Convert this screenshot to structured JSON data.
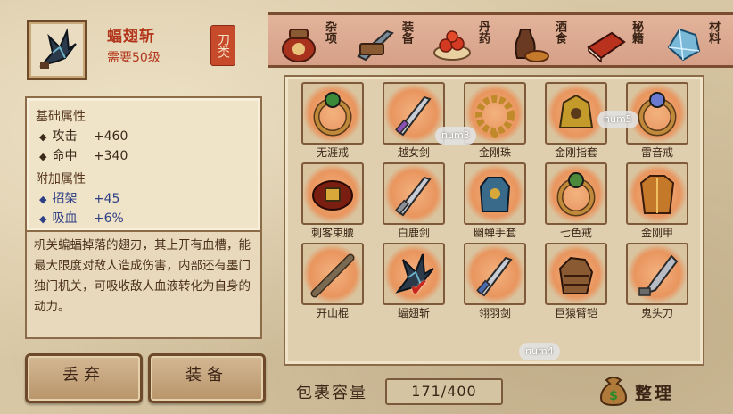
{
  "item": {
    "title": "蝠翅斩",
    "level_req": "需要50级",
    "type_seal": "刀类",
    "base_title": "基础属性",
    "base_stats": [
      {
        "name": "攻击",
        "value": "+460"
      },
      {
        "name": "命中",
        "value": "+340"
      }
    ],
    "extra_title": "附加属性",
    "extra_stats": [
      {
        "name": "招架",
        "value": "+45"
      },
      {
        "name": "吸血",
        "value": "+6%"
      }
    ],
    "description": "机关蝙蝠掉落的翅刃，其上开有血槽，能最大限度对敌人造成伤害，内部还有墨门独门机关，可吸收敌人血液转化为自身的动力。"
  },
  "buttons": {
    "discard": "丢弃",
    "equip": "装备"
  },
  "tabs": [
    {
      "label": "杂项",
      "icon": "jar-icon"
    },
    {
      "label": "装备",
      "icon": "weapon-icon"
    },
    {
      "label": "丹药",
      "icon": "pill-icon"
    },
    {
      "label": "酒食",
      "icon": "wine-food-icon"
    },
    {
      "label": "秘籍",
      "icon": "book-icon"
    },
    {
      "label": "材料",
      "icon": "crystal-icon"
    }
  ],
  "inventory": [
    {
      "name": "无涯戒",
      "icon": "ring-icon",
      "color": "#3b8a3a"
    },
    {
      "name": "越女剑",
      "icon": "sword-icon",
      "color": "#8b4fb3"
    },
    {
      "name": "金刚珠",
      "icon": "beads-icon",
      "color": "#c08a2a"
    },
    {
      "name": "金刚指套",
      "icon": "finger-guard-icon",
      "color": "#c49a2a"
    },
    {
      "name": "雷音戒",
      "icon": "ring-icon",
      "color": "#6a7ad0"
    },
    {
      "name": "刺客束腰",
      "icon": "belt-icon",
      "color": "#7a1e12"
    },
    {
      "name": "白鹿剑",
      "icon": "sword-icon",
      "color": "#8a8f98"
    },
    {
      "name": "幽蝉手套",
      "icon": "glove-icon",
      "color": "#3a6a8a"
    },
    {
      "name": "七色戒",
      "icon": "ring-icon",
      "color": "#4a8a3a"
    },
    {
      "name": "金刚甲",
      "icon": "armor-icon",
      "color": "#c4782a"
    },
    {
      "name": "开山棍",
      "icon": "staff-icon",
      "color": "#7a6a52"
    },
    {
      "name": "蝠翅斩",
      "icon": "bat-blade-icon",
      "color": "#2a3a4a"
    },
    {
      "name": "翎羽剑",
      "icon": "sword-icon",
      "color": "#4a6ab0"
    },
    {
      "name": "巨猿臂铠",
      "icon": "gauntlet-icon",
      "color": "#8a5a32"
    },
    {
      "name": "鬼头刀",
      "icon": "broadsword-icon",
      "color": "#6a6a6a"
    }
  ],
  "selected_item": "蝠翅斩",
  "badges": [
    "num3",
    "num5",
    "num4"
  ],
  "capacity": {
    "label": "包裹容量",
    "value": "171/400"
  },
  "sort_label": "整理"
}
